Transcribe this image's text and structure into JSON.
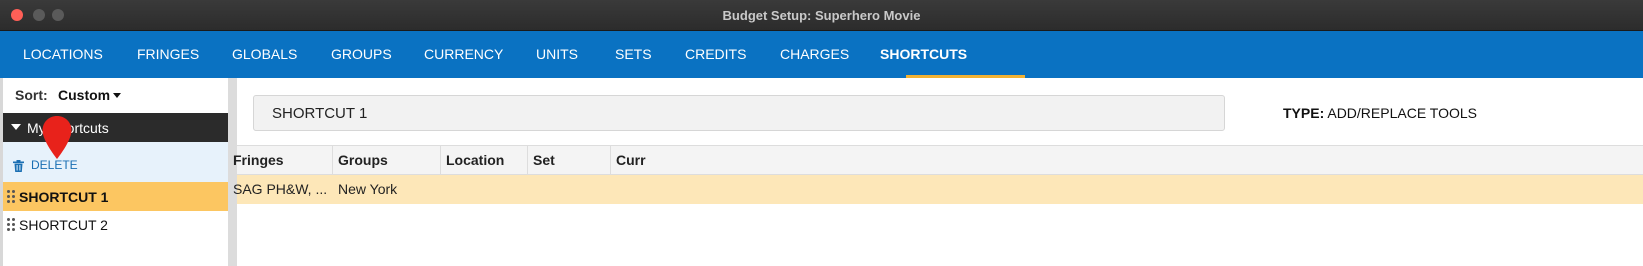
{
  "window": {
    "title": "Budget Setup: Superhero Movie"
  },
  "tabs": [
    {
      "label": "LOCATIONS"
    },
    {
      "label": "FRINGES"
    },
    {
      "label": "GLOBALS"
    },
    {
      "label": "GROUPS"
    },
    {
      "label": "CURRENCY"
    },
    {
      "label": "UNITS"
    },
    {
      "label": "SETS"
    },
    {
      "label": "CREDITS"
    },
    {
      "label": "CHARGES"
    },
    {
      "label": "SHORTCUTS"
    }
  ],
  "active_tab": "SHORTCUTS",
  "sidebar": {
    "sort_label": "Sort:",
    "sort_value": "Custom",
    "group_label": "My Shortcuts",
    "delete_label": "DELETE",
    "items": [
      {
        "label": "SHORTCUT 1",
        "selected": true
      },
      {
        "label": "SHORTCUT 2",
        "selected": false
      }
    ]
  },
  "main": {
    "name_value": "SHORTCUT 1",
    "type_label": "TYPE:",
    "type_value": "ADD/REPLACE TOOLS",
    "table": {
      "columns": [
        "Fringes",
        "Groups",
        "Location",
        "Set",
        "Curr"
      ],
      "rows": [
        [
          "SAG PH&W, ...",
          "New York",
          "",
          "",
          ""
        ]
      ]
    }
  },
  "colors": {
    "tab_bar": "#0a72c2",
    "tab_underline": "#f2b233",
    "selected_item": "#fcc661",
    "table_row": "#fde7b8",
    "pin": "#e8221b"
  }
}
